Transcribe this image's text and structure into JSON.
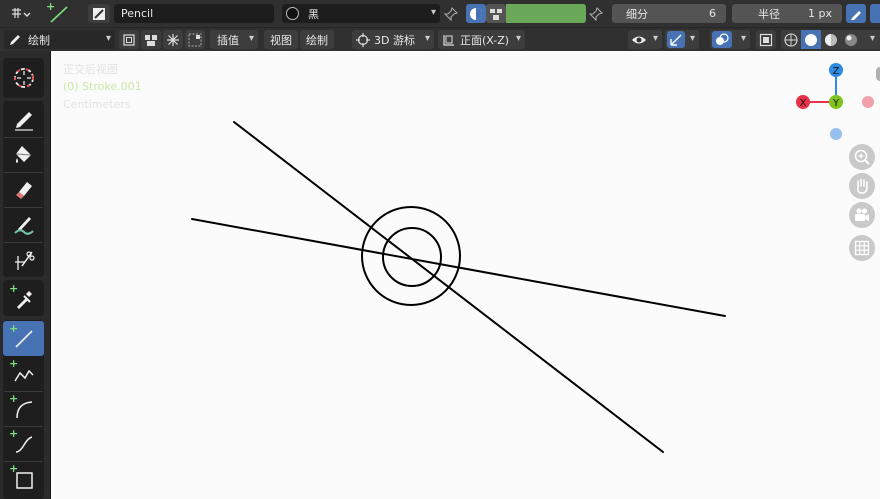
{
  "header": {
    "brush_name": "Pencil",
    "material_name": "黑",
    "subdivide_label": "细分",
    "subdivide_value": "6",
    "radius_label": "半径",
    "radius_value": "1 px",
    "strength_color": "#6aa85a"
  },
  "header2": {
    "mode_label": "绘制",
    "interpolate_label": "插值",
    "view_label": "视图",
    "draw_label": "绘制",
    "cursor_label": "3D 游标",
    "orientation_label": "正面(X-Z)"
  },
  "viewport": {
    "view_name": "正交后视图",
    "object_label": "(0) Stroke.001",
    "units_label": "Centimeters",
    "background_color": "#fbfbfb",
    "stroke_color": "#000000"
  },
  "gizmo": {
    "z_label": "Z",
    "y_label": "Y",
    "x_label": "X",
    "z_color": "#2b8be6",
    "y_color": "#7fc41d",
    "x_color": "#e8324a"
  },
  "toolbar": {
    "active_tool": "line",
    "active_color": "#4772b3"
  }
}
